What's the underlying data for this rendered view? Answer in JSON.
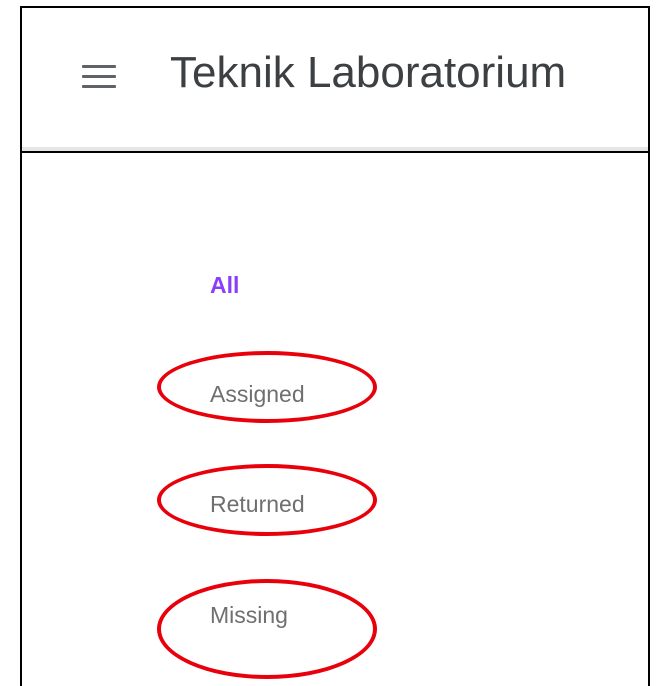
{
  "header": {
    "menu_icon": "hamburger-menu-icon",
    "title": "Teknik Laboratorium"
  },
  "filters": {
    "items": [
      {
        "label": "All",
        "active": true
      },
      {
        "label": "Assigned",
        "active": false
      },
      {
        "label": "Returned",
        "active": false
      },
      {
        "label": "Missing",
        "active": false
      }
    ]
  },
  "colors": {
    "active_filter": "#8b3dff",
    "inactive_filter": "#6f6f6f",
    "annotation": "#e8000b",
    "title_text": "#3c4043"
  }
}
